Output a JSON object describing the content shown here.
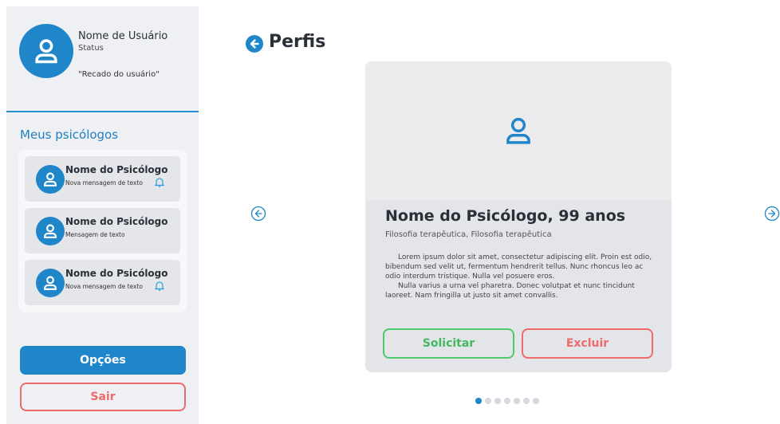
{
  "user": {
    "name": "Nome de Usuário",
    "status": "Status",
    "note": "\"Recado do usuário\""
  },
  "sidebar": {
    "section_title": "Meus psicólogos",
    "psychologists": [
      {
        "name": "Nome do Psicólogo",
        "message": "Nova mensagem de texto",
        "has_notification": true
      },
      {
        "name": "Nome do Psicólogo",
        "message": "Mensagem de texto",
        "has_notification": false
      },
      {
        "name": "Nome do Psicólogo",
        "message": "Nova mensagem de texto",
        "has_notification": true
      }
    ],
    "options_label": "Opções",
    "exit_label": "Sair"
  },
  "main": {
    "title": "Perfis",
    "card": {
      "name": "Nome do Psicólogo, 99 anos",
      "subtitle": "Filosofia terapêutica, Filosofia terapêutica",
      "bio": [
        "Lorem ipsum dolor sit amet, consectetur adipiscing elit. Proin est odio, bibendum sed velit ut, fermentum hendrerit tellus. Nunc rhoncus leo ac odio interdum tristique. Nulla vel posuere eros.",
        "Nulla varius a urna vel pharetra. Donec volutpat et nunc tincidunt laoreet. Nam fringilla ut justo sit amet convallis."
      ],
      "request_label": "Solicitar",
      "delete_label": "Excluir"
    },
    "pagination": {
      "current": 1,
      "total": 7
    }
  },
  "colors": {
    "accent": "#1f86c9",
    "success": "#4ec96b",
    "danger": "#ef6b6b",
    "sidebar_bg": "#eef0f3",
    "card_bg": "#e3e5e9"
  },
  "icons": {
    "avatar": "user-icon",
    "back": "arrow-left-circle-icon",
    "prev": "arrow-left-circle-outline-icon",
    "next": "arrow-right-circle-outline-icon",
    "notification": "bell-icon"
  }
}
